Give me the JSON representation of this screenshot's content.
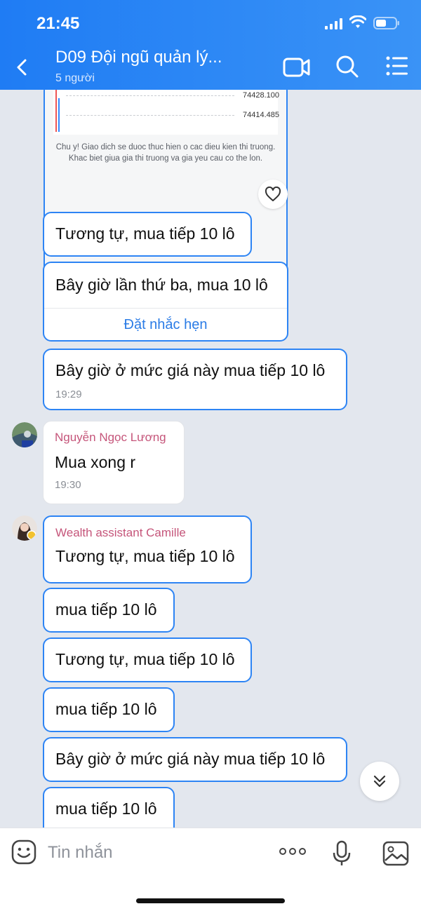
{
  "status_bar": {
    "time": "21:45"
  },
  "header": {
    "title": "D09 Đội ngũ quản lý...",
    "subtitle": "5 người"
  },
  "chart_card": {
    "prices": [
      "74428.100",
      "74414.485"
    ],
    "note": "Chu y! Giao dich se duoc thuc hien o cac dieu kien thi truong. Khac biet giua gia thi truong va gia yeu cau co the lon."
  },
  "messages": [
    {
      "text": "Tương tự, mua tiếp 10 lô"
    },
    {
      "text": "Bây giờ lần thứ ba, mua 10 lô",
      "action": "Đặt nhắc hẹn"
    },
    {
      "text": "Bây giờ ở mức giá này mua tiếp 10 lô",
      "time": "19:29"
    },
    {
      "sender": "Nguyễn Ngọc Lương",
      "text": "Mua xong r",
      "time": "19:30"
    },
    {
      "sender": "Wealth assistant Camille",
      "text": "Tương tự, mua tiếp 10 lô"
    },
    {
      "text": "mua tiếp 10 lô"
    },
    {
      "text": "Tương tự, mua tiếp 10 lô"
    },
    {
      "text": "mua tiếp 10 lô"
    },
    {
      "text": "Bây giờ ở mức giá này mua tiếp 10 lô"
    },
    {
      "text": "mua tiếp 10 lô"
    }
  ],
  "input": {
    "placeholder": "Tin nhắn"
  },
  "colors": {
    "header": "#1f7cf4",
    "bubble_border": "#2d84f4",
    "sender": "#c5557a",
    "background": "#e3e7ee"
  },
  "icons": [
    "back-icon",
    "video-call-icon",
    "search-icon",
    "menu-icon",
    "heart-icon",
    "chevron-double-down-icon",
    "emoji-icon",
    "more-icon",
    "mic-icon",
    "image-icon"
  ]
}
